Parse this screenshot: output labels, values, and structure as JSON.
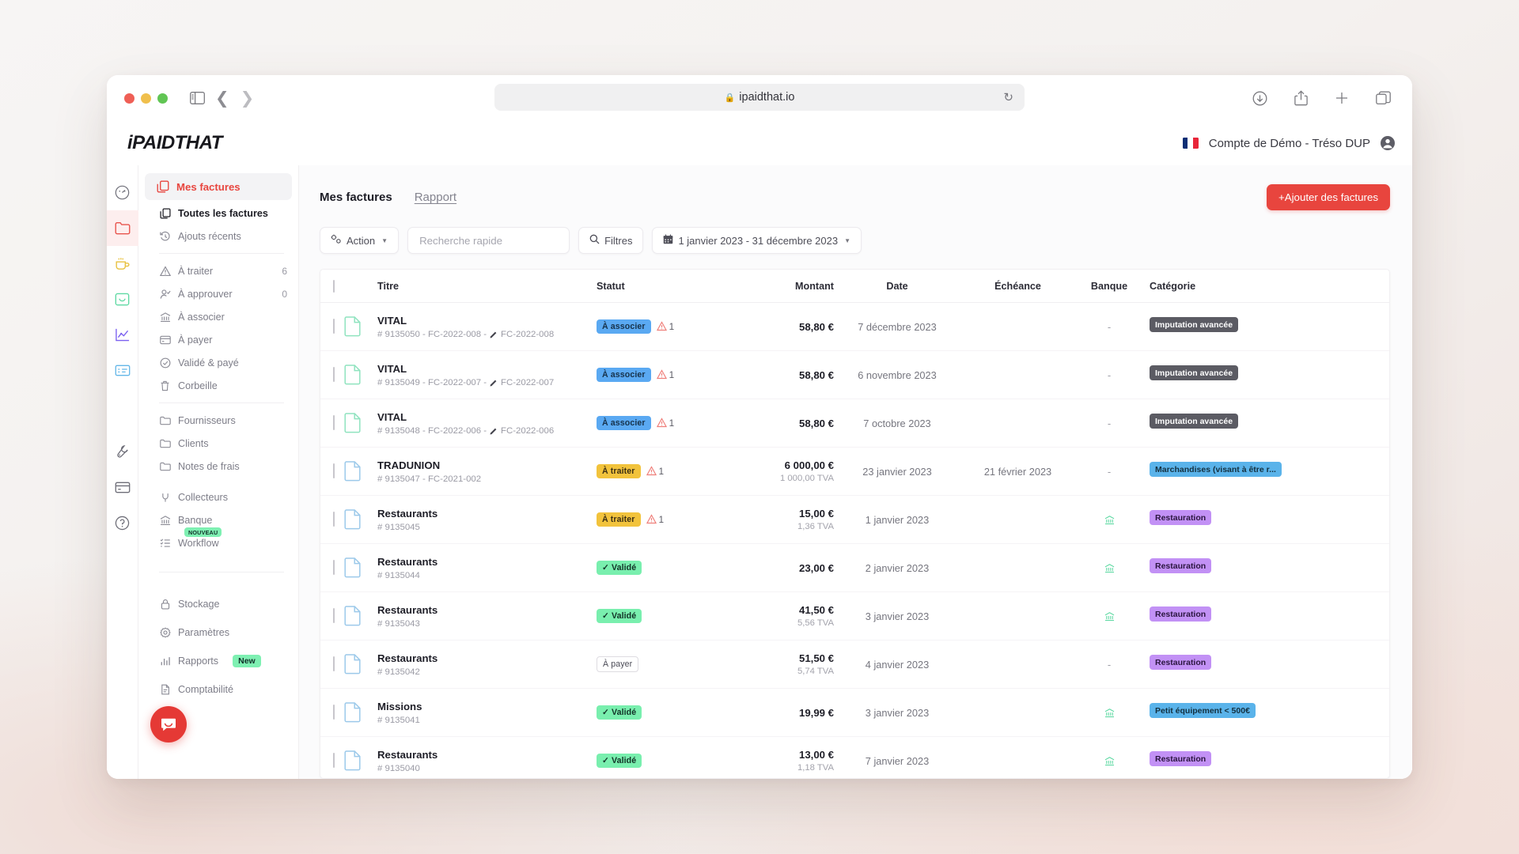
{
  "browser": {
    "url": "ipaidthat.io",
    "lock_icon": "lock-icon",
    "reload_icon": "reload-icon",
    "sidebar_toggle_icon": "sidebar-toggle-icon",
    "back_icon": "chevron-left-icon",
    "forward_icon": "chevron-right-icon",
    "shield_icon": "shield-icon",
    "downloads_icon": "download-icon",
    "share_icon": "share-icon",
    "new_tab_icon": "plus-icon",
    "tabs_icon": "tabs-icon"
  },
  "app_header": {
    "logo_i": "i",
    "logo_paid": "PAID",
    "logo_that": "THAT",
    "language_flag": "fr-flag-icon",
    "account_name": "Compte de Démo - Tréso DUP",
    "avatar_icon": "user-circle-icon"
  },
  "rail": [
    {
      "name": "dashboard-icon",
      "color": "#6e6e78",
      "active": false
    },
    {
      "name": "folder-icon",
      "color": "#e8534c",
      "active": true
    },
    {
      "name": "cup-icon",
      "color": "#e8c13f",
      "active": false
    },
    {
      "name": "inbox-icon",
      "color": "#5fd9a3",
      "active": false
    },
    {
      "name": "chart-icon",
      "color": "#7b61f0",
      "active": false
    },
    {
      "name": "invoice-icon",
      "color": "#63b6e8",
      "active": false
    },
    {
      "name": "wrench-icon",
      "color": "#6e6e78",
      "active": false
    },
    {
      "name": "card-icon",
      "color": "#6e6e78",
      "active": false
    },
    {
      "name": "help-icon",
      "color": "#6e6e78",
      "active": false
    }
  ],
  "sidebar": {
    "header": {
      "label": "Mes factures",
      "icon": "copy-documents-icon"
    },
    "group1": [
      {
        "label": "Toutes les factures",
        "icon": "copy-documents-icon",
        "count": "",
        "selected": true
      },
      {
        "label": "Ajouts récents",
        "icon": "history-icon",
        "count": "",
        "selected": false
      }
    ],
    "group2": [
      {
        "label": "À traiter",
        "icon": "warning-triangle-icon",
        "count": "6"
      },
      {
        "label": "À approuver",
        "icon": "user-check-icon",
        "count": "0"
      },
      {
        "label": "À associer",
        "icon": "bank-icon",
        "count": ""
      },
      {
        "label": "À payer",
        "icon": "credit-card-icon",
        "count": ""
      },
      {
        "label": "Validé & payé",
        "icon": "check-circle-icon",
        "count": ""
      },
      {
        "label": "Corbeille",
        "icon": "trash-icon",
        "count": ""
      }
    ],
    "group3": [
      {
        "label": "Fournisseurs",
        "icon": "folder-outline-icon"
      },
      {
        "label": "Clients",
        "icon": "folder-outline-icon"
      },
      {
        "label": "Notes de frais",
        "icon": "folder-outline-icon"
      }
    ],
    "group4": [
      {
        "label": "Collecteurs",
        "icon": "plug-icon",
        "badge": ""
      },
      {
        "label": "Banque",
        "icon": "bank-icon",
        "badge": ""
      },
      {
        "label": "Workflow",
        "icon": "checklist-icon",
        "badge": "NOUVEAU"
      }
    ],
    "group5": [
      {
        "label": "Stockage",
        "icon": "lock-icon",
        "badge": ""
      },
      {
        "label": "Paramètres",
        "icon": "gear-icon",
        "badge": ""
      },
      {
        "label": "Rapports",
        "icon": "bar-chart-icon",
        "badge": "New"
      },
      {
        "label": "Comptabilité",
        "icon": "document-icon",
        "badge": ""
      }
    ],
    "chat_icon": "chat-bubble-icon"
  },
  "main": {
    "tabs": [
      {
        "label": "Mes factures",
        "active": true
      },
      {
        "label": "Rapport",
        "active": false
      }
    ],
    "add_button": "+Ajouter des factures",
    "toolbar": {
      "action_label": "Action",
      "action_icon": "settings-sliders-icon",
      "search_placeholder": "Recherche rapide",
      "search_value": "",
      "filters_label": "Filtres",
      "filters_icon": "search-icon",
      "date_range": "1 janvier 2023 - 31 décembre 2023",
      "calendar_icon": "calendar-icon"
    },
    "columns": [
      "",
      "",
      "Titre",
      "Statut",
      "Montant",
      "Date",
      "Échéance",
      "Banque",
      "Catégorie"
    ],
    "rows": [
      {
        "title": "VITAL",
        "ref": "# 9135050 - FC-2022-008 - ",
        "ref2": "FC-2022-008",
        "has_pencil": true,
        "doc_color": "#8fe3bf",
        "status": "À associer",
        "status_style": "bg-associer",
        "warn": "1",
        "amount": "58,80 €",
        "tva": "",
        "date": "7 décembre 2023",
        "echeance": "",
        "bank": "-",
        "bank_icon": false,
        "category": "Imputation avancée",
        "cat_style": "cat-gray"
      },
      {
        "title": "VITAL",
        "ref": "# 9135049 - FC-2022-007 - ",
        "ref2": "FC-2022-007",
        "has_pencil": true,
        "doc_color": "#8fe3bf",
        "status": "À associer",
        "status_style": "bg-associer",
        "warn": "1",
        "amount": "58,80 €",
        "tva": "",
        "date": "6 novembre 2023",
        "echeance": "",
        "bank": "-",
        "bank_icon": false,
        "category": "Imputation avancée",
        "cat_style": "cat-gray"
      },
      {
        "title": "VITAL",
        "ref": "# 9135048 - FC-2022-006 - ",
        "ref2": "FC-2022-006",
        "has_pencil": true,
        "doc_color": "#8fe3bf",
        "status": "À associer",
        "status_style": "bg-associer",
        "warn": "1",
        "amount": "58,80 €",
        "tva": "",
        "date": "7 octobre 2023",
        "echeance": "",
        "bank": "-",
        "bank_icon": false,
        "category": "Imputation avancée",
        "cat_style": "cat-gray"
      },
      {
        "title": "TRADUNION",
        "ref": "# 9135047 - FC-2021-002",
        "ref2": "",
        "has_pencil": false,
        "doc_color": "#9cc9ea",
        "status": "À traiter",
        "status_style": "bg-traiter",
        "warn": "1",
        "amount": "6 000,00 €",
        "tva": "1 000,00 TVA",
        "date": "23 janvier 2023",
        "echeance": "21 février 2023",
        "bank": "-",
        "bank_icon": false,
        "category": "Marchandises (visant à être r...",
        "cat_style": "cat-blue"
      },
      {
        "title": "Restaurants",
        "ref": "# 9135045",
        "ref2": "",
        "has_pencil": false,
        "doc_color": "#9cc9ea",
        "status": "À traiter",
        "status_style": "bg-traiter",
        "warn": "1",
        "amount": "15,00 €",
        "tva": "1,36 TVA",
        "date": "1 janvier 2023",
        "echeance": "",
        "bank": "",
        "bank_icon": true,
        "category": "Restauration",
        "cat_style": "cat-purp"
      },
      {
        "title": "Restaurants",
        "ref": "# 9135044",
        "ref2": "",
        "has_pencil": false,
        "doc_color": "#9cc9ea",
        "status": "✓ Validé",
        "status_style": "bg-valide",
        "warn": "",
        "amount": "23,00 €",
        "tva": "",
        "date": "2 janvier 2023",
        "echeance": "",
        "bank": "",
        "bank_icon": true,
        "category": "Restauration",
        "cat_style": "cat-purp"
      },
      {
        "title": "Restaurants",
        "ref": "# 9135043",
        "ref2": "",
        "has_pencil": false,
        "doc_color": "#9cc9ea",
        "status": "✓ Validé",
        "status_style": "bg-valide",
        "warn": "",
        "amount": "41,50 €",
        "tva": "5,56 TVA",
        "date": "3 janvier 2023",
        "echeance": "",
        "bank": "",
        "bank_icon": true,
        "category": "Restauration",
        "cat_style": "cat-purp"
      },
      {
        "title": "Restaurants",
        "ref": "# 9135042",
        "ref2": "",
        "has_pencil": false,
        "doc_color": "#9cc9ea",
        "status": "À payer",
        "status_style": "bg-payer",
        "warn": "",
        "amount": "51,50 €",
        "tva": "5,74 TVA",
        "date": "4 janvier 2023",
        "echeance": "",
        "bank": "-",
        "bank_icon": false,
        "category": "Restauration",
        "cat_style": "cat-purp"
      },
      {
        "title": "Missions",
        "ref": "# 9135041",
        "ref2": "",
        "has_pencil": false,
        "doc_color": "#9cc9ea",
        "status": "✓ Validé",
        "status_style": "bg-valide",
        "warn": "",
        "amount": "19,99 €",
        "tva": "",
        "date": "3 janvier 2023",
        "echeance": "",
        "bank": "",
        "bank_icon": true,
        "category": "Petit équipement < 500€",
        "cat_style": "cat-blue"
      },
      {
        "title": "Restaurants",
        "ref": "# 9135040",
        "ref2": "",
        "has_pencil": false,
        "doc_color": "#9cc9ea",
        "status": "✓ Validé",
        "status_style": "bg-valide",
        "warn": "",
        "amount": "13,00 €",
        "tva": "1,18 TVA",
        "date": "7 janvier 2023",
        "echeance": "",
        "bank": "",
        "bank_icon": true,
        "category": "Restauration",
        "cat_style": "cat-purp"
      }
    ]
  },
  "colors": {
    "accent_red": "#e8453e",
    "badge_blue": "#5aa9f2",
    "badge_yellow": "#f2c33c",
    "badge_green": "#79efae",
    "cat_gray": "#5b5b63",
    "cat_purple": "#c291f5",
    "cat_blue": "#5ab3ea"
  }
}
